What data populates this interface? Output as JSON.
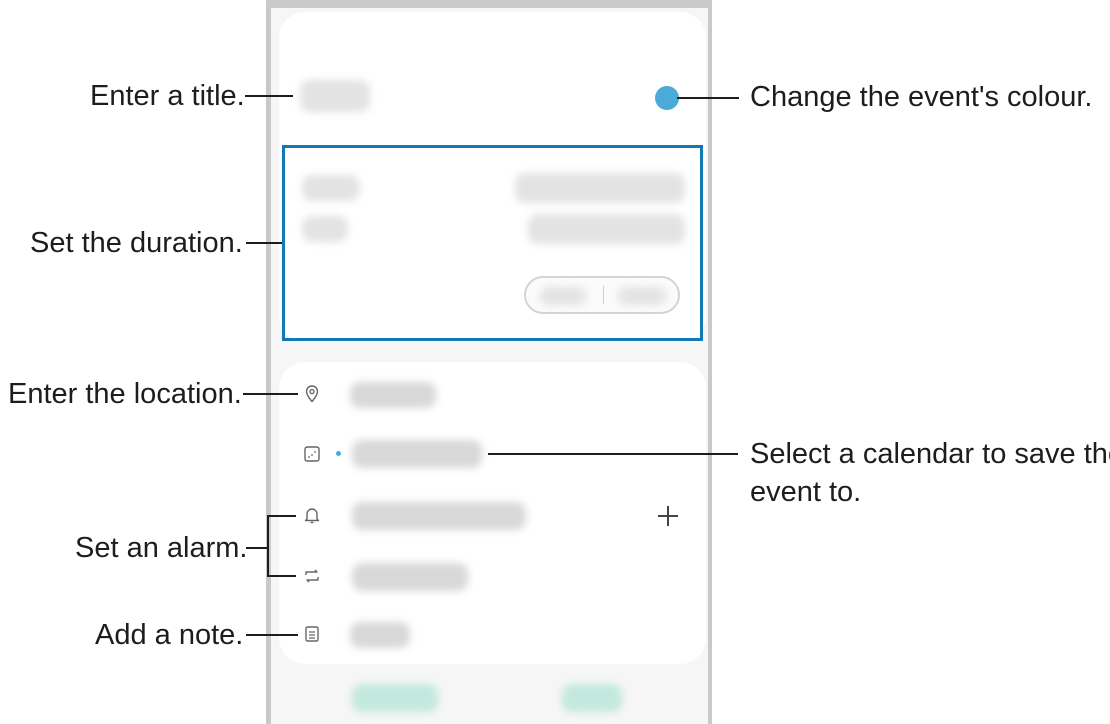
{
  "callouts": {
    "title": "Enter a title.",
    "duration": "Set the duration.",
    "location": "Enter the location.",
    "alarm": "Set an alarm.",
    "note": "Add a note.",
    "colour": "Change the event's colour.",
    "calendar_line1": "Select a calendar to save the",
    "calendar_line2": "event to."
  },
  "form": {
    "add_icon": "+"
  },
  "icons": {
    "location": "location-pin-icon",
    "calendar": "calendar-icon",
    "alarm": "bell-icon",
    "repeat": "repeat-icon",
    "note": "note-icon",
    "add": "plus-icon"
  },
  "colors": {
    "highlight_border": "#1179b5",
    "event_colour": "#4aabd8",
    "annotation_text": "#1d1d1b"
  }
}
